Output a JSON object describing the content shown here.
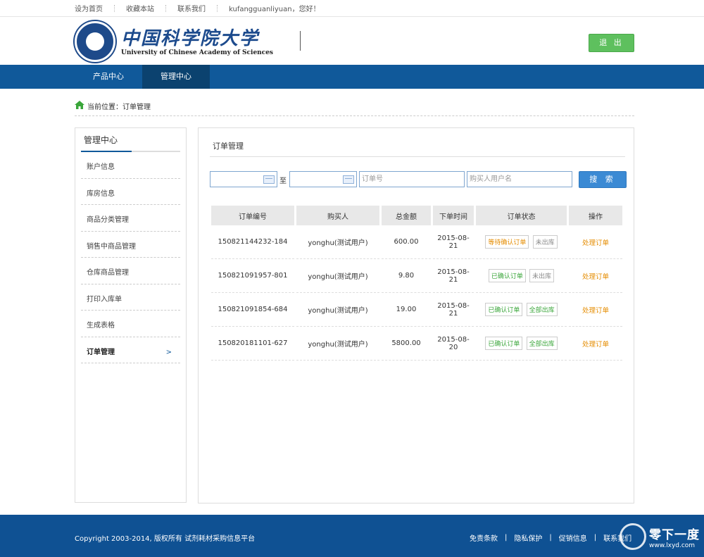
{
  "topbar": {
    "set_home": "设为首页",
    "bookmark": "收藏本站",
    "contact": "联系我们",
    "greeting": "kufangguanliyuan，您好！"
  },
  "header": {
    "logo_cn": "中国科学院大学",
    "logo_en": "University of Chinese Academy of Sciences",
    "logout": "退 出"
  },
  "nav": {
    "items": [
      "产品中心",
      "管理中心"
    ],
    "active": 1
  },
  "breadcrumb": "当前位置：订单管理",
  "sidebar": {
    "title": "管理中心",
    "items": [
      "账户信息",
      "库房信息",
      "商品分类管理",
      "销售中商品管理",
      "仓库商品管理",
      "打印入库单",
      "生成表格",
      "订单管理"
    ],
    "active_arrow": ">"
  },
  "main": {
    "title": "订单管理",
    "filters": {
      "to": "至",
      "order_no_placeholder": "订单号",
      "buyer_placeholder": "购买人用户名",
      "search": "搜 索"
    },
    "table": {
      "headers": [
        "订单编号",
        "购买人",
        "总金额",
        "下单时间",
        "订单状态",
        "操作"
      ],
      "rows": [
        {
          "id": "150821144232-184",
          "buyer": "yonghu(测试用户)",
          "amount": "600.00",
          "date": "2015-08-21",
          "status1": "等待确认订单",
          "status2": "未出库",
          "action": "处理订单"
        },
        {
          "id": "150821091957-801",
          "buyer": "yonghu(测试用户)",
          "amount": "9.80",
          "date": "2015-08-21",
          "status1": "已确认订单",
          "status2": "未出库",
          "action": "处理订单"
        },
        {
          "id": "150821091854-684",
          "buyer": "yonghu(测试用户)",
          "amount": "19.00",
          "date": "2015-08-21",
          "status1": "已确认订单",
          "status2": "全部出库",
          "action": "处理订单"
        },
        {
          "id": "150820181101-627",
          "buyer": "yonghu(测试用户)",
          "amount": "5800.00",
          "date": "2015-08-20",
          "status1": "已确认订单",
          "status2": "全部出库",
          "action": "处理订单"
        }
      ]
    }
  },
  "footer": {
    "copyright": "Copyright 2003-2014, 版权所有 试剂耗材采购信息平台",
    "links": [
      "免责条款",
      "隐私保护",
      "促销信息",
      "联系我们"
    ],
    "separator": "|",
    "watermark_cn": "零下一度",
    "watermark_en": "www.lxyd.com"
  },
  "colors": {
    "nav": "#10599a",
    "nav_active": "#0b426f",
    "logout": "#5ec05e",
    "search": "#3b8ad4",
    "warning": "#e58c00",
    "ok": "#3aa63a",
    "footer": "#0f5193"
  }
}
